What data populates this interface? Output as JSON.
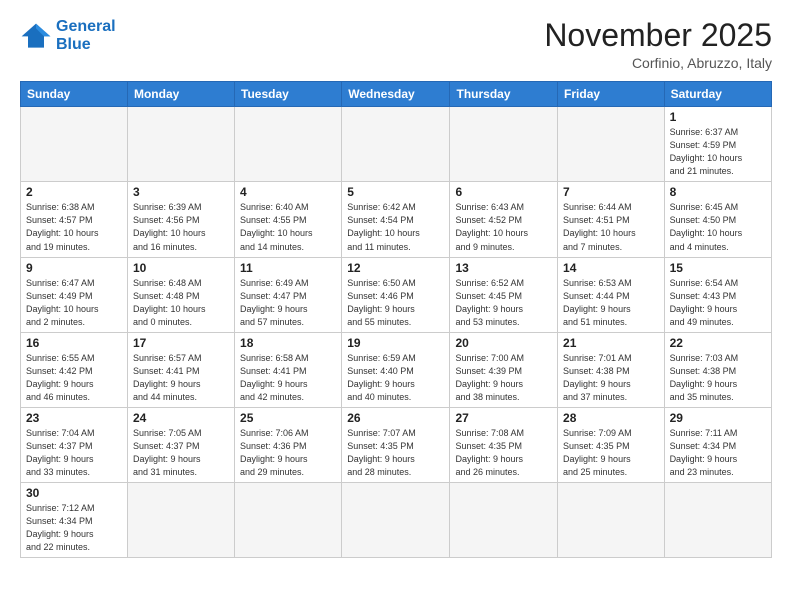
{
  "logo": {
    "line1": "General",
    "line2": "Blue"
  },
  "title": "November 2025",
  "subtitle": "Corfinio, Abruzzo, Italy",
  "weekdays": [
    "Sunday",
    "Monday",
    "Tuesday",
    "Wednesday",
    "Thursday",
    "Friday",
    "Saturday"
  ],
  "weeks": [
    [
      {
        "day": "",
        "info": ""
      },
      {
        "day": "",
        "info": ""
      },
      {
        "day": "",
        "info": ""
      },
      {
        "day": "",
        "info": ""
      },
      {
        "day": "",
        "info": ""
      },
      {
        "day": "",
        "info": ""
      },
      {
        "day": "1",
        "info": "Sunrise: 6:37 AM\nSunset: 4:59 PM\nDaylight: 10 hours\nand 21 minutes."
      }
    ],
    [
      {
        "day": "2",
        "info": "Sunrise: 6:38 AM\nSunset: 4:57 PM\nDaylight: 10 hours\nand 19 minutes."
      },
      {
        "day": "3",
        "info": "Sunrise: 6:39 AM\nSunset: 4:56 PM\nDaylight: 10 hours\nand 16 minutes."
      },
      {
        "day": "4",
        "info": "Sunrise: 6:40 AM\nSunset: 4:55 PM\nDaylight: 10 hours\nand 14 minutes."
      },
      {
        "day": "5",
        "info": "Sunrise: 6:42 AM\nSunset: 4:54 PM\nDaylight: 10 hours\nand 11 minutes."
      },
      {
        "day": "6",
        "info": "Sunrise: 6:43 AM\nSunset: 4:52 PM\nDaylight: 10 hours\nand 9 minutes."
      },
      {
        "day": "7",
        "info": "Sunrise: 6:44 AM\nSunset: 4:51 PM\nDaylight: 10 hours\nand 7 minutes."
      },
      {
        "day": "8",
        "info": "Sunrise: 6:45 AM\nSunset: 4:50 PM\nDaylight: 10 hours\nand 4 minutes."
      }
    ],
    [
      {
        "day": "9",
        "info": "Sunrise: 6:47 AM\nSunset: 4:49 PM\nDaylight: 10 hours\nand 2 minutes."
      },
      {
        "day": "10",
        "info": "Sunrise: 6:48 AM\nSunset: 4:48 PM\nDaylight: 10 hours\nand 0 minutes."
      },
      {
        "day": "11",
        "info": "Sunrise: 6:49 AM\nSunset: 4:47 PM\nDaylight: 9 hours\nand 57 minutes."
      },
      {
        "day": "12",
        "info": "Sunrise: 6:50 AM\nSunset: 4:46 PM\nDaylight: 9 hours\nand 55 minutes."
      },
      {
        "day": "13",
        "info": "Sunrise: 6:52 AM\nSunset: 4:45 PM\nDaylight: 9 hours\nand 53 minutes."
      },
      {
        "day": "14",
        "info": "Sunrise: 6:53 AM\nSunset: 4:44 PM\nDaylight: 9 hours\nand 51 minutes."
      },
      {
        "day": "15",
        "info": "Sunrise: 6:54 AM\nSunset: 4:43 PM\nDaylight: 9 hours\nand 49 minutes."
      }
    ],
    [
      {
        "day": "16",
        "info": "Sunrise: 6:55 AM\nSunset: 4:42 PM\nDaylight: 9 hours\nand 46 minutes."
      },
      {
        "day": "17",
        "info": "Sunrise: 6:57 AM\nSunset: 4:41 PM\nDaylight: 9 hours\nand 44 minutes."
      },
      {
        "day": "18",
        "info": "Sunrise: 6:58 AM\nSunset: 4:41 PM\nDaylight: 9 hours\nand 42 minutes."
      },
      {
        "day": "19",
        "info": "Sunrise: 6:59 AM\nSunset: 4:40 PM\nDaylight: 9 hours\nand 40 minutes."
      },
      {
        "day": "20",
        "info": "Sunrise: 7:00 AM\nSunset: 4:39 PM\nDaylight: 9 hours\nand 38 minutes."
      },
      {
        "day": "21",
        "info": "Sunrise: 7:01 AM\nSunset: 4:38 PM\nDaylight: 9 hours\nand 37 minutes."
      },
      {
        "day": "22",
        "info": "Sunrise: 7:03 AM\nSunset: 4:38 PM\nDaylight: 9 hours\nand 35 minutes."
      }
    ],
    [
      {
        "day": "23",
        "info": "Sunrise: 7:04 AM\nSunset: 4:37 PM\nDaylight: 9 hours\nand 33 minutes."
      },
      {
        "day": "24",
        "info": "Sunrise: 7:05 AM\nSunset: 4:37 PM\nDaylight: 9 hours\nand 31 minutes."
      },
      {
        "day": "25",
        "info": "Sunrise: 7:06 AM\nSunset: 4:36 PM\nDaylight: 9 hours\nand 29 minutes."
      },
      {
        "day": "26",
        "info": "Sunrise: 7:07 AM\nSunset: 4:35 PM\nDaylight: 9 hours\nand 28 minutes."
      },
      {
        "day": "27",
        "info": "Sunrise: 7:08 AM\nSunset: 4:35 PM\nDaylight: 9 hours\nand 26 minutes."
      },
      {
        "day": "28",
        "info": "Sunrise: 7:09 AM\nSunset: 4:35 PM\nDaylight: 9 hours\nand 25 minutes."
      },
      {
        "day": "29",
        "info": "Sunrise: 7:11 AM\nSunset: 4:34 PM\nDaylight: 9 hours\nand 23 minutes."
      }
    ],
    [
      {
        "day": "30",
        "info": "Sunrise: 7:12 AM\nSunset: 4:34 PM\nDaylight: 9 hours\nand 22 minutes."
      },
      {
        "day": "",
        "info": ""
      },
      {
        "day": "",
        "info": ""
      },
      {
        "day": "",
        "info": ""
      },
      {
        "day": "",
        "info": ""
      },
      {
        "day": "",
        "info": ""
      },
      {
        "day": "",
        "info": ""
      }
    ]
  ]
}
